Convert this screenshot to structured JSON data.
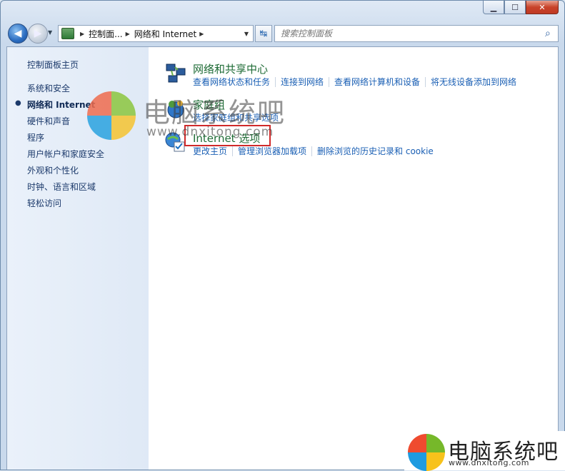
{
  "window": {
    "minimize_glyph": "▁",
    "maximize_glyph": "☐",
    "close_glyph": "✕"
  },
  "toolbar": {
    "back_glyph": "◀",
    "forward_glyph": "▶",
    "breadcrumbs": [
      "控制面...",
      "网络和 Internet"
    ],
    "refresh_glyph": "↹",
    "search_placeholder": "搜索控制面板",
    "search_glyph": "⌕"
  },
  "sidebar": {
    "items": [
      {
        "label": "控制面板主页"
      },
      {
        "label": "系统和安全"
      },
      {
        "label": "网络和 Internet",
        "active": true
      },
      {
        "label": "硬件和声音"
      },
      {
        "label": "程序"
      },
      {
        "label": "用户帐户和家庭安全"
      },
      {
        "label": "外观和个性化"
      },
      {
        "label": "时钟、语言和区域"
      },
      {
        "label": "轻松访问"
      }
    ]
  },
  "categories": [
    {
      "title": "网络和共享中心",
      "icon": "network-sharing-center-icon",
      "links": [
        "查看网络状态和任务",
        "连接到网络",
        "查看网络计算机和设备",
        "将无线设备添加到网络"
      ]
    },
    {
      "title": "家庭组",
      "icon": "homegroup-icon",
      "links": [
        "选择家庭组和共享选项"
      ]
    },
    {
      "title": "Internet 选项",
      "icon": "internet-options-icon",
      "highlighted": true,
      "links": [
        "更改主页",
        "管理浏览器加载项",
        "删除浏览的历史记录和 cookie"
      ]
    }
  ],
  "watermark": {
    "text": "电脑系统吧",
    "url": "www.dnxitong.com"
  },
  "logo": {
    "text": "电脑系统吧",
    "url": "www.dnxitong.com"
  },
  "colors": {
    "link": "#1a5fb4",
    "category_title": "#1e6b35",
    "highlight": "#d02a2a"
  }
}
